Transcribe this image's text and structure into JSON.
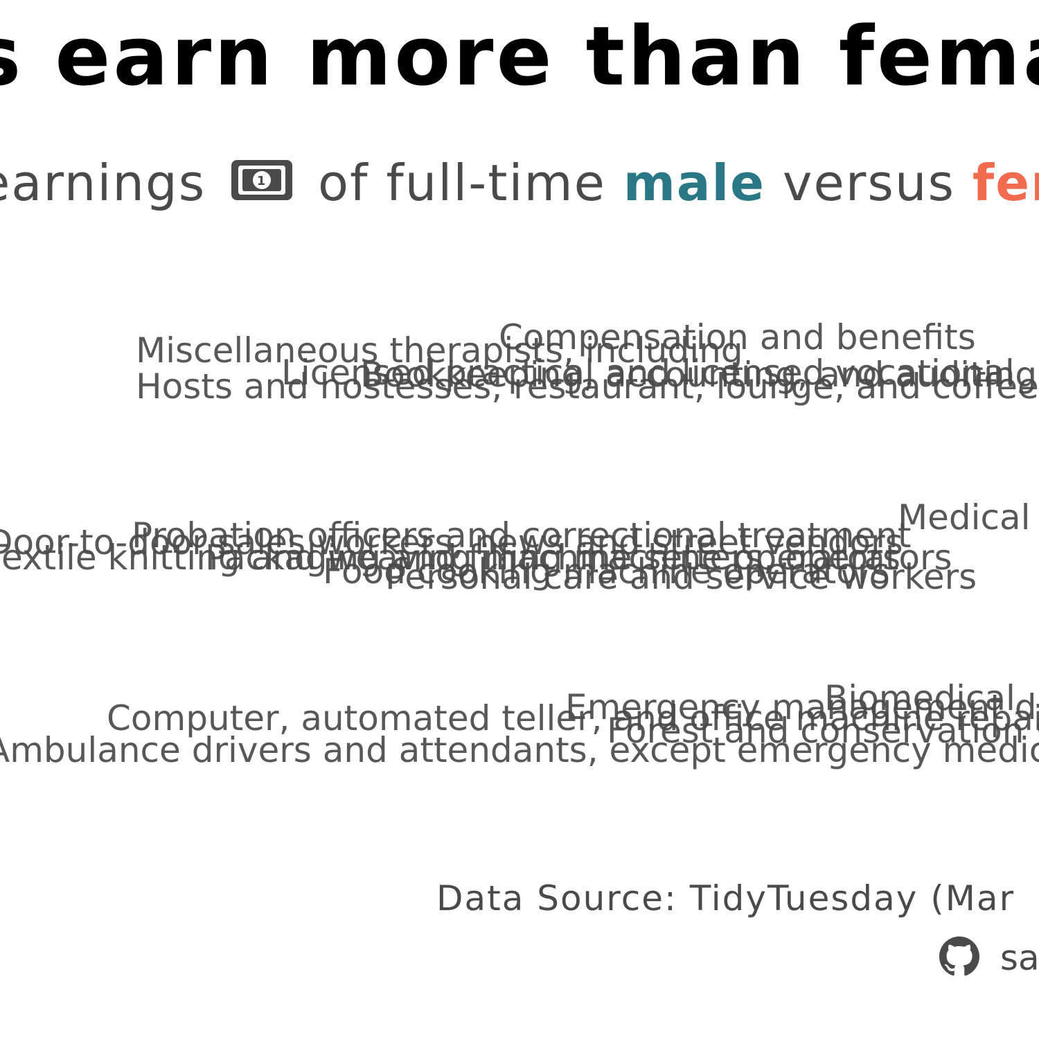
{
  "chart_data": {
    "type": "bar",
    "title": "s earn more than female",
    "subtitle": {
      "part1": "earnings",
      "icon": "money-bill-icon",
      "part2": "of full-time",
      "male": "male",
      "part3": "versus",
      "female": "fem"
    },
    "series": [
      {
        "name": "male",
        "color": "#2a7886"
      },
      {
        "name": "female",
        "color": "#f26b4f"
      }
    ],
    "groups": [
      {
        "occupations": [
          "Compensation and benefits",
          "Miscellaneous therapists, including",
          "Licensed practical and licensed vocational",
          "Bookkeeping, accounting, and auditing",
          "Hosts and hostesses, restaurant, lounge, and coffee"
        ]
      },
      {
        "occupations": [
          "Medical",
          "Probation officers and correctional treatment",
          "Door-to-door sales workers, news and street vendors",
          "Textile knitting and weaving machine setters, operators",
          "Packaging and filling machine operators",
          "Food cooking machine operators",
          "Personal care and service workers"
        ]
      },
      {
        "occupations": [
          "Biomedical",
          "Emergency management directors",
          "Computer, automated teller, and office machine repairers",
          "Forest and conservation workers",
          "Ambulance drivers and attendants, except emergency medical technicians"
        ]
      }
    ],
    "caption": "Data Source: TidyTuesday (Mar",
    "author": "sar",
    "author_icon": "github-icon"
  }
}
